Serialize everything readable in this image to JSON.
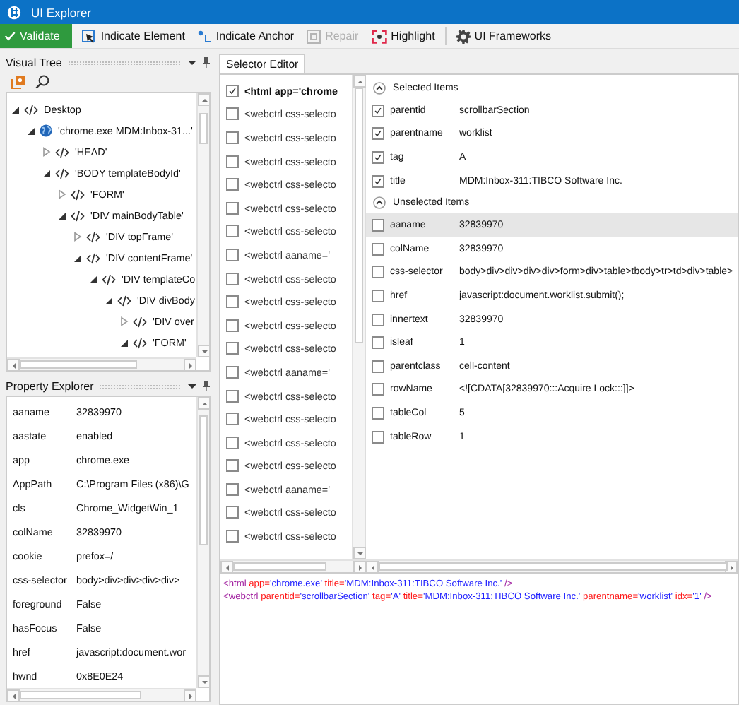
{
  "window": {
    "title": "UI Explorer"
  },
  "toolbar": [
    {
      "kind": "validate",
      "label": "Validate",
      "disabled": false
    },
    {
      "kind": "indicate-element",
      "label": "Indicate Element",
      "disabled": false
    },
    {
      "kind": "indicate-anchor",
      "label": "Indicate Anchor",
      "disabled": false
    },
    {
      "kind": "repair",
      "label": "Repair",
      "disabled": true
    },
    {
      "kind": "highlight",
      "label": "Highlight",
      "disabled": false
    },
    {
      "kind": "frameworks",
      "label": "UI Frameworks",
      "disabled": false
    }
  ],
  "visual_tree": {
    "title": "Visual Tree",
    "nodes": [
      {
        "kind": "html",
        "label": "Desktop",
        "expanded": true,
        "children": [
          {
            "kind": "browser",
            "label": "'chrome.exe MDM:Inbox-31...'",
            "expanded": true,
            "children": [
              {
                "kind": "html",
                "label": "'HEAD'",
                "expanded": false
              },
              {
                "kind": "html",
                "label": "'BODY  templateBodyId'",
                "expanded": true,
                "children": [
                  {
                    "kind": "html",
                    "label": "'FORM'",
                    "expanded": false
                  },
                  {
                    "kind": "html",
                    "label": "'DIV  mainBodyTable'",
                    "expanded": true,
                    "children": [
                      {
                        "kind": "html",
                        "label": "'DIV  topFrame'",
                        "expanded": false
                      },
                      {
                        "kind": "html",
                        "label": "'DIV  contentFrame'",
                        "expanded": true,
                        "children": [
                          {
                            "kind": "html",
                            "label": "'DIV  templateCo",
                            "expanded": true,
                            "children": [
                              {
                                "kind": "html",
                                "label": "'DIV  divBody",
                                "expanded": true,
                                "children": [
                                  {
                                    "kind": "html",
                                    "label": "'DIV  over",
                                    "expanded": false
                                  },
                                  {
                                    "kind": "html",
                                    "label": "'FORM'",
                                    "expanded": true
                                  }
                                ]
                              }
                            ]
                          }
                        ]
                      }
                    ]
                  }
                ]
              }
            ]
          }
        ]
      }
    ]
  },
  "property_explorer": {
    "title": "Property Explorer",
    "rows": [
      {
        "name": "aaname",
        "value": "32839970"
      },
      {
        "name": "aastate",
        "value": "enabled"
      },
      {
        "name": "app",
        "value": "chrome.exe"
      },
      {
        "name": "AppPath",
        "value": "C:\\Program Files (x86)\\G"
      },
      {
        "name": "cls",
        "value": "Chrome_WidgetWin_1"
      },
      {
        "name": "colName",
        "value": "32839970"
      },
      {
        "name": "cookie",
        "value": "prefox=/"
      },
      {
        "name": "css-selector",
        "value": "body>div>div>div>div>"
      },
      {
        "name": "foreground",
        "value": "False"
      },
      {
        "name": "hasFocus",
        "value": "False"
      },
      {
        "name": "href",
        "value": "javascript:document.wor"
      },
      {
        "name": "hwnd",
        "value": "0x8E0E24"
      }
    ]
  },
  "selector_editor": {
    "tab": "Selector Editor",
    "nodes": [
      {
        "text": "<html app='chrome",
        "checked": true
      },
      {
        "text": "<webctrl css-selecto",
        "checked": false
      },
      {
        "text": "<webctrl css-selecto",
        "checked": false
      },
      {
        "text": "<webctrl css-selecto",
        "checked": false
      },
      {
        "text": "<webctrl css-selecto",
        "checked": false
      },
      {
        "text": "<webctrl css-selecto",
        "checked": false
      },
      {
        "text": "<webctrl css-selecto",
        "checked": false
      },
      {
        "text": "<webctrl aaname='",
        "checked": false
      },
      {
        "text": "<webctrl css-selecto",
        "checked": false
      },
      {
        "text": "<webctrl css-selecto",
        "checked": false
      },
      {
        "text": "<webctrl css-selecto",
        "checked": false
      },
      {
        "text": "<webctrl css-selecto",
        "checked": false
      },
      {
        "text": "<webctrl aaname='",
        "checked": false
      },
      {
        "text": "<webctrl css-selecto",
        "checked": false
      },
      {
        "text": "<webctrl css-selecto",
        "checked": false
      },
      {
        "text": "<webctrl css-selecto",
        "checked": false
      },
      {
        "text": "<webctrl css-selecto",
        "checked": false
      },
      {
        "text": "<webctrl aaname='",
        "checked": false
      },
      {
        "text": "<webctrl css-selecto",
        "checked": false
      },
      {
        "text": "<webctrl css-selecto",
        "checked": false
      }
    ],
    "groups": [
      {
        "title": "Selected Items",
        "expanded": true,
        "rows": [
          {
            "name": "parentid",
            "value": "scrollbarSection",
            "checked": true,
            "selected": false
          },
          {
            "name": "parentname",
            "value": "worklist",
            "checked": true,
            "selected": false
          },
          {
            "name": "tag",
            "value": "A",
            "checked": true,
            "selected": false
          },
          {
            "name": "title",
            "value": "MDM:Inbox-311:TIBCO Software Inc.",
            "checked": true,
            "selected": false
          }
        ]
      },
      {
        "title": "Unselected Items",
        "expanded": true,
        "rows": [
          {
            "name": "aaname",
            "value": "32839970",
            "checked": false,
            "selected": true
          },
          {
            "name": "colName",
            "value": "32839970",
            "checked": false,
            "selected": false
          },
          {
            "name": "css-selector",
            "value": "body>div>div>div>div>form>div>table>tbody>tr>td>div>table>",
            "checked": false,
            "selected": false
          },
          {
            "name": "href",
            "value": "javascript:document.worklist.submit();",
            "checked": false,
            "selected": false
          },
          {
            "name": "innertext",
            "value": "32839970",
            "checked": false,
            "selected": false
          },
          {
            "name": "isleaf",
            "value": "1",
            "checked": false,
            "selected": false
          },
          {
            "name": "parentclass",
            "value": "cell-content",
            "checked": false,
            "selected": false
          },
          {
            "name": "rowName",
            "value": "<![CDATA[32839970:::Acquire Lock:::]]>",
            "checked": false,
            "selected": false
          },
          {
            "name": "tableCol",
            "value": "5",
            "checked": false,
            "selected": false
          },
          {
            "name": "tableRow",
            "value": "1",
            "checked": false,
            "selected": false
          }
        ]
      }
    ],
    "code": [
      [
        {
          "kind": "tag",
          "text": "<html"
        },
        {
          "kind": "attr",
          "text": " app="
        },
        {
          "kind": "value",
          "text": "'chrome.exe'"
        },
        {
          "kind": "attr",
          "text": " title="
        },
        {
          "kind": "value",
          "text": "'MDM:Inbox-311:TIBCO Software Inc.'"
        },
        {
          "kind": "tag",
          "text": " />"
        }
      ],
      [
        {
          "kind": "tag",
          "text": "<webctrl"
        },
        {
          "kind": "attr",
          "text": " parentid="
        },
        {
          "kind": "value",
          "text": "'scrollbarSection'"
        },
        {
          "kind": "attr",
          "text": " tag="
        },
        {
          "kind": "value",
          "text": "'A'"
        },
        {
          "kind": "attr",
          "text": " title="
        },
        {
          "kind": "value",
          "text": "'MDM:Inbox-311:TIBCO Software Inc.'"
        },
        {
          "kind": "attr",
          "text": " parentname="
        },
        {
          "kind": "value",
          "text": "'worklist'"
        },
        {
          "kind": "attr",
          "text": " idx="
        },
        {
          "kind": "value",
          "text": "'1'"
        },
        {
          "kind": "tag",
          "text": " />"
        }
      ]
    ]
  }
}
